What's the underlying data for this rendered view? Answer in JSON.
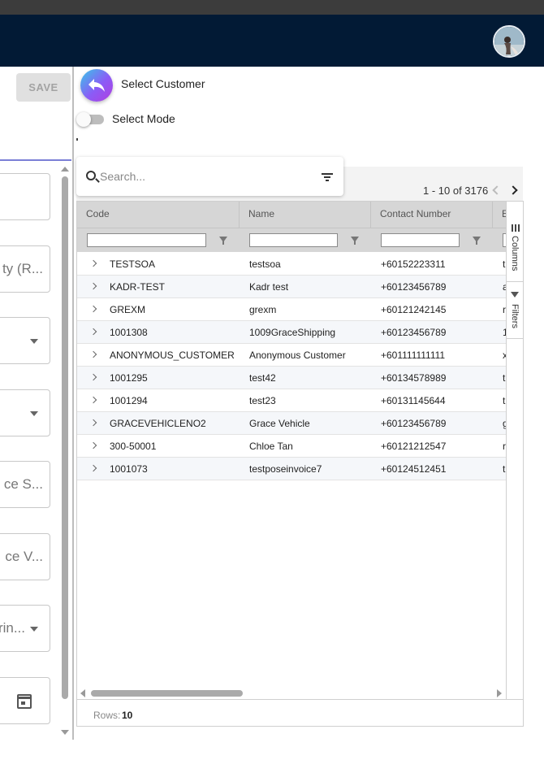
{
  "header": {
    "avatar": "user-avatar"
  },
  "form": {
    "save_label": "SAVE",
    "fields": [
      {
        "text": "",
        "type": "text"
      },
      {
        "text": "ty (R...",
        "type": "text"
      },
      {
        "text": "",
        "type": "select"
      },
      {
        "text": "",
        "type": "select"
      },
      {
        "text": "ce S...",
        "type": "text"
      },
      {
        "text": "ce V...",
        "type": "text"
      },
      {
        "text": "rin...",
        "type": "select"
      },
      {
        "text": "",
        "type": "date"
      }
    ]
  },
  "dialog": {
    "title": "Select Customer",
    "select_mode_label": "Select Mode",
    "select_mode_on": false,
    "search_placeholder": "Search...",
    "pager": "1 - 10 of 3176",
    "rows_label": "Rows:",
    "rows_value": "10",
    "columns": [
      "Code",
      "Name",
      "Contact Number",
      "E"
    ],
    "side_tabs": [
      "Columns",
      "Filters"
    ],
    "rows": [
      {
        "code": "TESTSOA",
        "name": "testsoa",
        "contact": "+60152223311",
        "extra": "t"
      },
      {
        "code": "KADR-TEST",
        "name": "Kadr test",
        "contact": "+60123456789",
        "extra": "a"
      },
      {
        "code": "GREXM",
        "name": "grexm",
        "contact": "+60121242145",
        "extra": "r"
      },
      {
        "code": "1001308",
        "name": "1009GraceShipping",
        "contact": "+60123456789",
        "extra": "1"
      },
      {
        "code": "ANONYMOUS_CUSTOMER",
        "name": "Anonymous Customer",
        "contact": "+601111111111",
        "extra": "x"
      },
      {
        "code": "1001295",
        "name": "test42",
        "contact": "+60134578989",
        "extra": "t"
      },
      {
        "code": "1001294",
        "name": "test23",
        "contact": "+60131145644",
        "extra": "t"
      },
      {
        "code": "GRACEVEHICLENO2",
        "name": "Grace Vehicle",
        "contact": "+60123456789",
        "extra": "g"
      },
      {
        "code": "300-50001",
        "name": "Chloe Tan",
        "contact": "+60121212547",
        "extra": "r"
      },
      {
        "code": "1001073",
        "name": "testposeinvoice7",
        "contact": "+60124512451",
        "extra": "t"
      }
    ]
  },
  "colors": {
    "navbar": "#021a35",
    "accent": "#7b7fd6",
    "header_bg": "#d6d6d6"
  }
}
